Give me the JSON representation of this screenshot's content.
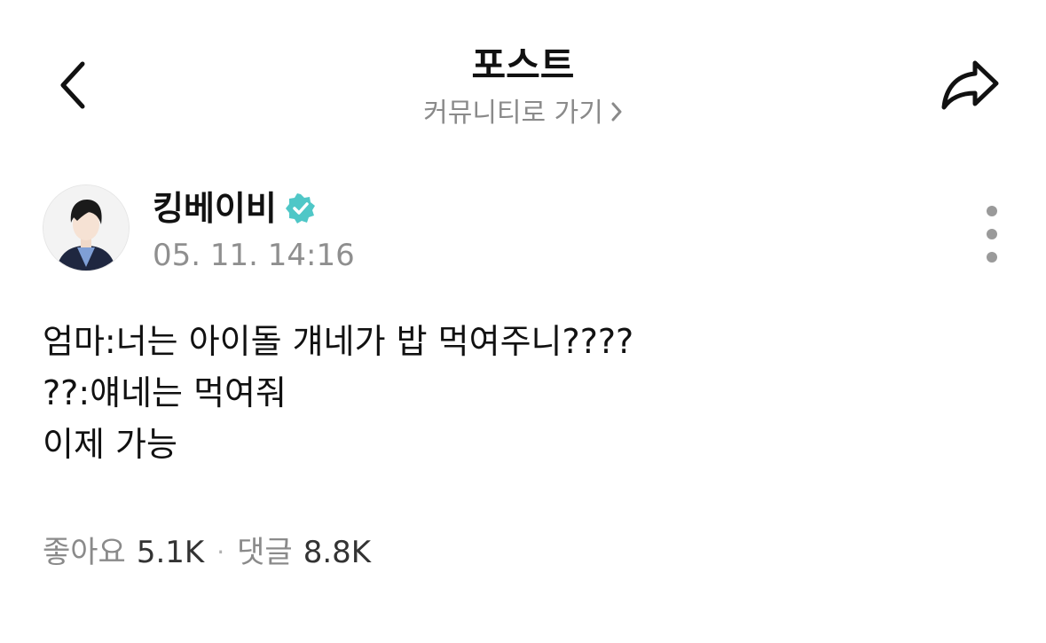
{
  "header": {
    "title": "포스트",
    "community_link": "커뮤니티로 가기",
    "back_icon": "chevron-left-icon",
    "share_icon": "share-icon",
    "community_chevron_icon": "chevron-right-icon"
  },
  "post": {
    "author": {
      "name": "킹베이비",
      "verified": true,
      "verified_color": "#4fc7c7"
    },
    "timestamp": "05. 11. 14:16",
    "more_icon": "more-vertical-icon",
    "lines": [
      "엄마:너는 아이돌 걔네가 밥 먹여주니????",
      "??:얘네는 먹여줘",
      "이제 가능"
    ]
  },
  "stats": {
    "likes_label": "좋아요",
    "likes_value": "5.1K",
    "separator": "·",
    "comments_label": "댓글",
    "comments_value": "8.8K"
  }
}
